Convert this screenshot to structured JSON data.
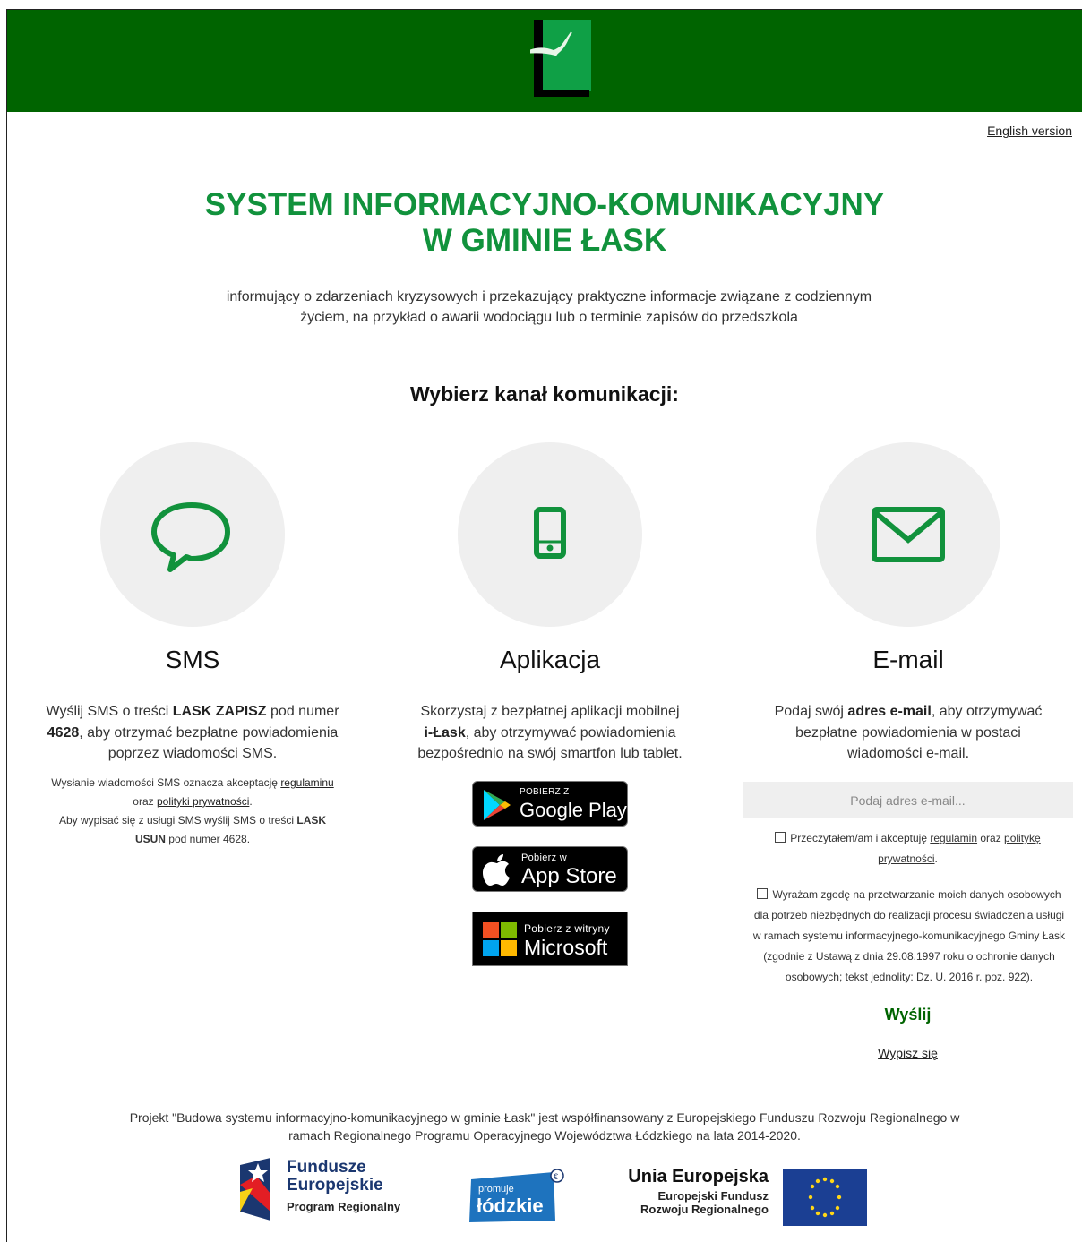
{
  "header": {
    "logo_icon": "lask-logo-icon",
    "background": "#006400"
  },
  "language_link": "English version",
  "title_line1": "SYSTEM INFORMACYJNO-KOMUNIKACYJNY",
  "title_line2": "W GMINIE ŁASK",
  "subtitle_line1": "informujący o zdarzeniach kryzysowych i przekazujący praktyczne informacje związane z codziennym",
  "subtitle_line2": "życiem, na przykład o awarii wodociągu lub o terminie zapisów do przedszkola",
  "choose_channel": "Wybierz kanał komunikacji:",
  "accent_color": "#11923c",
  "sms": {
    "icon": "speech-bubble-icon",
    "title": "SMS",
    "text_a": "Wyślij SMS o treści ",
    "text_b": "LASK ZAPISZ",
    "text_c": " pod numer",
    "text_d": "4628",
    "text_e": ", aby otrzymać bezpłatne powiadomienia",
    "text_f": "poprzez wiadomości SMS.",
    "note1_a": "Wysłanie wiadomości SMS oznacza akceptację ",
    "note1_link": "regulaminu",
    "note1_b": "oraz ",
    "note1_link2": "polityki prywatności",
    "note1_c": ".",
    "note2_a": "Aby wypisać się z usługi SMS wyślij SMS o treści ",
    "note2_b": "LASK",
    "note2_c": "USUN",
    "note2_d": " pod numer 4628."
  },
  "app": {
    "icon": "smartphone-icon",
    "title": "Aplikacja",
    "text_a": "Skorzystaj z bezpłatnej aplikacji mobilnej",
    "text_b": "i-Łask",
    "text_c": ", aby otrzymywać powiadomienia",
    "text_d": "bezpośrednio na swój smartfon lub tablet.",
    "google_small": "POBIERZ Z",
    "google_big": "Google Play",
    "apple_small": "Pobierz w",
    "apple_big": "App Store",
    "ms_small": "Pobierz z witryny",
    "ms_big": "Microsoft"
  },
  "email": {
    "icon": "envelope-icon",
    "title": "E-mail",
    "text_a": "Podaj swój ",
    "text_b": "adres e-mail",
    "text_c": ", aby otrzymywać",
    "text_d": "bezpłatne powiadomienia w postaci",
    "text_e": "wiadomości e-mail.",
    "input_placeholder": "Podaj adres e-mail...",
    "consent1_a": "Przeczytałem/am i akceptuję ",
    "consent1_link": "regulamin",
    "consent1_b": " oraz ",
    "consent1_link2": "politykę",
    "consent1_link3": "prywatności",
    "consent1_c": ".",
    "consent2_l1": "Wyrażam zgodę na przetwarzanie moich danych osobowych",
    "consent2_l2": "dla potrzeb niezbędnych do realizacji procesu świadczenia usługi",
    "consent2_l3": "w ramach systemu informacyjnego-komunikacyjnego Gminy Łask",
    "consent2_l4": "(zgodnie z Ustawą z dnia 29.08.1997 roku o ochronie danych",
    "consent2_l5": "osobowych; tekst jednolity: Dz. U. 2016 r. poz. 922).",
    "send": "Wyślij",
    "unsubscribe": "Wypisz się"
  },
  "footer": {
    "line1": "Projekt \"Budowa systemu informacyjno-komunikacyjnego w gminie Łask\" jest współfinansowany z Europejskiego Funduszu Rozwoju Regionalnego w",
    "line2": "ramach Regionalnego Programu Operacyjnego Województwa Łódzkiego na lata 2014-2020.",
    "fe_line1": "Fundusze",
    "fe_line2": "Europejskie",
    "fe_line3": "Program Regionalny",
    "lodzkie_small": "promuje",
    "lodzkie_big": "łódzkie",
    "ue_line1": "Unia Europejska",
    "ue_line2": "Europejski Fundusz",
    "ue_line3": "Rozwoju Regionalnego"
  }
}
